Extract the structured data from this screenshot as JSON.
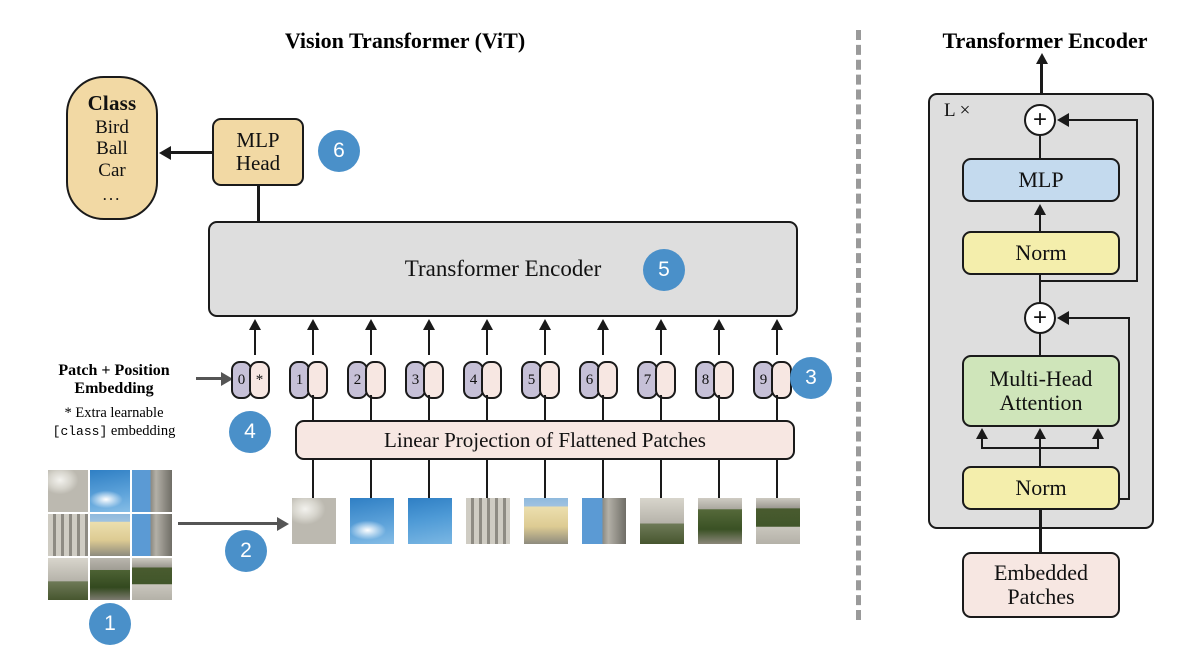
{
  "figure": {
    "left_title": "Vision Transformer (ViT)",
    "right_title": "Transformer Encoder"
  },
  "class_head": {
    "heading": "Class",
    "items": [
      "Bird",
      "Ball",
      "Car"
    ],
    "ellipsis": "..."
  },
  "mlp_head": {
    "line1": "MLP",
    "line2": "Head"
  },
  "encoder_block": {
    "label": "Transformer Encoder"
  },
  "linear_projection": {
    "label": "Linear Projection of Flattened Patches"
  },
  "embedding_labels": {
    "main_line1": "Patch + Position",
    "main_line2": "Embedding",
    "note_line1": "* Extra learnable",
    "note_token": "[class]",
    "note_line2_tail": " embedding"
  },
  "tokens": {
    "class_token": {
      "position": "0",
      "patch": "*"
    },
    "items": [
      {
        "position": "1"
      },
      {
        "position": "2"
      },
      {
        "position": "3"
      },
      {
        "position": "4"
      },
      {
        "position": "5"
      },
      {
        "position": "6"
      },
      {
        "position": "7"
      },
      {
        "position": "8"
      },
      {
        "position": "9"
      }
    ]
  },
  "badges": [
    {
      "id": "badge-1",
      "label": "1"
    },
    {
      "id": "badge-2",
      "label": "2"
    },
    {
      "id": "badge-3",
      "label": "3"
    },
    {
      "id": "badge-4",
      "label": "4"
    },
    {
      "id": "badge-5",
      "label": "5"
    },
    {
      "id": "badge-6",
      "label": "6"
    }
  ],
  "encoder_detail": {
    "repeat_label": "L ×",
    "plus_top": "+",
    "plus_bottom": "+",
    "mlp": "MLP",
    "norm_top": "Norm",
    "attention_line1": "Multi-Head",
    "attention_line2": "Attention",
    "norm_bottom": "Norm",
    "embedded_line1": "Embedded",
    "embedded_line2": "Patches"
  },
  "colors": {
    "badge_blue": "#4a90c9",
    "tan": "#f2d9a4",
    "gray": "#dedede",
    "pink": "#f7e7e2",
    "light_blue": "#c4daee",
    "yellow": "#f4eeac",
    "green": "#cfe5ba",
    "position_purple": "#c6c0d7",
    "stroke": "#1a1a1a",
    "divider_gray": "#9a9a9a"
  },
  "patch_grid": {
    "rows": 3,
    "cols": 3,
    "tiles": [
      "bldg-dome",
      "skycloud",
      "bldg-tower",
      "bldg-fac",
      "bldg-yellow",
      "bldg-tower",
      "bldg-wing",
      "garden",
      "path"
    ]
  },
  "patch_sequence": {
    "count": 9,
    "tiles": [
      "bldg-dome",
      "skycloud",
      "sky",
      "bldg-fac",
      "bldg-yellow",
      "bldg-tower",
      "bldg-wing",
      "garden2",
      "path"
    ]
  }
}
